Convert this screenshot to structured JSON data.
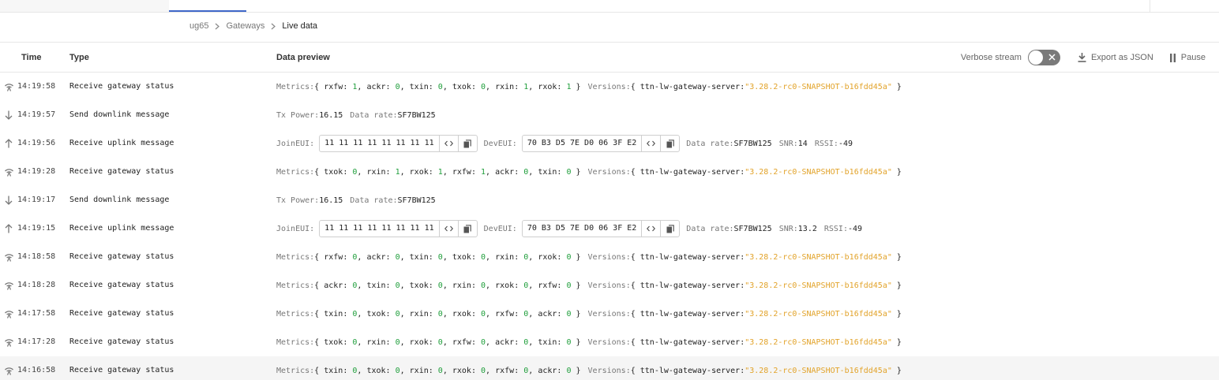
{
  "breadcrumb": [
    "ug65",
    "Gateways",
    "Live data"
  ],
  "columns": {
    "time": "Time",
    "type": "Type",
    "preview": "Data preview"
  },
  "controls": {
    "verbose": "Verbose stream",
    "export": "Export as JSON",
    "pause": "Pause"
  },
  "labels": {
    "metrics": "Metrics:",
    "versions": "Versions:",
    "server_key": "ttn-lw-gateway-server:",
    "tx_power": "Tx Power:",
    "data_rate": "Data rate:",
    "join_eui": "JoinEUI:",
    "dev_eui": "DevEUI:",
    "snr": "SNR:",
    "rssi": "RSSI:"
  },
  "icons": {
    "status": "gateway-status-icon",
    "down": "arrow-down-icon",
    "up": "arrow-up-icon"
  },
  "rows": [
    {
      "time": "14:19:58",
      "type": "Receive gateway status",
      "kind": "status",
      "metrics": [
        [
          "rxfw",
          "1"
        ],
        [
          "ackr",
          "0"
        ],
        [
          "txin",
          "0"
        ],
        [
          "txok",
          "0"
        ],
        [
          "rxin",
          "1"
        ],
        [
          "rxok",
          "1"
        ]
      ],
      "version": "\"3.28.2-rc0-SNAPSHOT-b16fdd45a\""
    },
    {
      "time": "14:19:57",
      "type": "Send downlink message",
      "kind": "down",
      "tx_power": "16.15",
      "data_rate": "SF7BW125"
    },
    {
      "time": "14:19:56",
      "type": "Receive uplink message",
      "kind": "up",
      "join_eui": "11 11 11 11 11 11 11 11",
      "dev_eui": "70 B3 D5 7E D0 06 3F E2",
      "data_rate": "SF7BW125",
      "snr": "14",
      "rssi": "-49"
    },
    {
      "time": "14:19:28",
      "type": "Receive gateway status",
      "kind": "status",
      "metrics": [
        [
          "txok",
          "0"
        ],
        [
          "rxin",
          "1"
        ],
        [
          "rxok",
          "1"
        ],
        [
          "rxfw",
          "1"
        ],
        [
          "ackr",
          "0"
        ],
        [
          "txin",
          "0"
        ]
      ],
      "version": "\"3.28.2-rc0-SNAPSHOT-b16fdd45a\""
    },
    {
      "time": "14:19:17",
      "type": "Send downlink message",
      "kind": "down",
      "tx_power": "16.15",
      "data_rate": "SF7BW125"
    },
    {
      "time": "14:19:15",
      "type": "Receive uplink message",
      "kind": "up",
      "join_eui": "11 11 11 11 11 11 11 11",
      "dev_eui": "70 B3 D5 7E D0 06 3F E2",
      "data_rate": "SF7BW125",
      "snr": "13.2",
      "rssi": "-49"
    },
    {
      "time": "14:18:58",
      "type": "Receive gateway status",
      "kind": "status",
      "metrics": [
        [
          "rxfw",
          "0"
        ],
        [
          "ackr",
          "0"
        ],
        [
          "txin",
          "0"
        ],
        [
          "txok",
          "0"
        ],
        [
          "rxin",
          "0"
        ],
        [
          "rxok",
          "0"
        ]
      ],
      "version": "\"3.28.2-rc0-SNAPSHOT-b16fdd45a\""
    },
    {
      "time": "14:18:28",
      "type": "Receive gateway status",
      "kind": "status",
      "metrics": [
        [
          "ackr",
          "0"
        ],
        [
          "txin",
          "0"
        ],
        [
          "txok",
          "0"
        ],
        [
          "rxin",
          "0"
        ],
        [
          "rxok",
          "0"
        ],
        [
          "rxfw",
          "0"
        ]
      ],
      "version": "\"3.28.2-rc0-SNAPSHOT-b16fdd45a\""
    },
    {
      "time": "14:17:58",
      "type": "Receive gateway status",
      "kind": "status",
      "metrics": [
        [
          "txin",
          "0"
        ],
        [
          "txok",
          "0"
        ],
        [
          "rxin",
          "0"
        ],
        [
          "rxok",
          "0"
        ],
        [
          "rxfw",
          "0"
        ],
        [
          "ackr",
          "0"
        ]
      ],
      "version": "\"3.28.2-rc0-SNAPSHOT-b16fdd45a\""
    },
    {
      "time": "14:17:28",
      "type": "Receive gateway status",
      "kind": "status",
      "metrics": [
        [
          "txok",
          "0"
        ],
        [
          "rxin",
          "0"
        ],
        [
          "rxok",
          "0"
        ],
        [
          "rxfw",
          "0"
        ],
        [
          "ackr",
          "0"
        ],
        [
          "txin",
          "0"
        ]
      ],
      "version": "\"3.28.2-rc0-SNAPSHOT-b16fdd45a\""
    },
    {
      "time": "14:16:58",
      "type": "Receive gateway status",
      "kind": "status",
      "metrics": [
        [
          "txin",
          "0"
        ],
        [
          "txok",
          "0"
        ],
        [
          "rxin",
          "0"
        ],
        [
          "rxok",
          "0"
        ],
        [
          "rxfw",
          "0"
        ],
        [
          "ackr",
          "0"
        ]
      ],
      "version": "\"3.28.2-rc0-SNAPSHOT-b16fdd45a\""
    }
  ]
}
